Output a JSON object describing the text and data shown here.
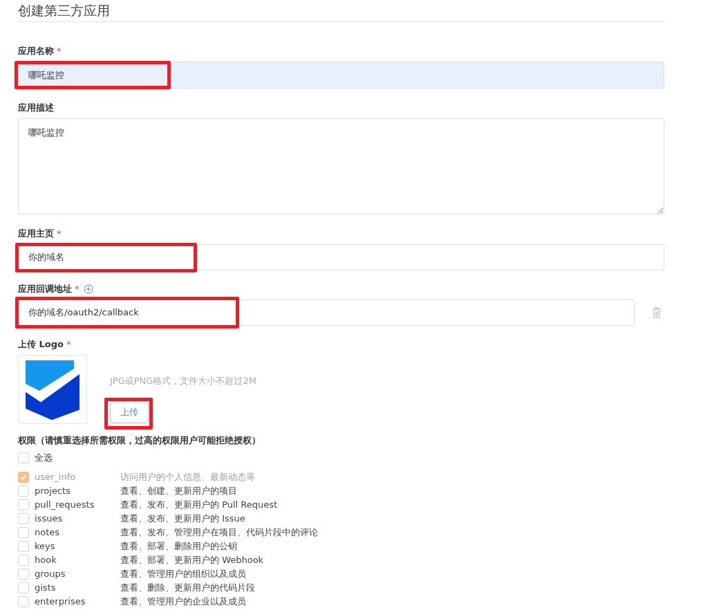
{
  "title": "创建第三方应用",
  "name_field": {
    "label": "应用名称",
    "required_mark": "*",
    "value": "哪吒监控",
    "autofilled": true,
    "highlighted": true
  },
  "description_field": {
    "label": "应用描述",
    "value": "哪吒监控"
  },
  "homepage_field": {
    "label": "应用主页",
    "required_mark": "*",
    "value": "你的域名",
    "highlighted": true
  },
  "callback_field": {
    "label": "应用回调地址",
    "required_mark": "*",
    "value": "你的域名/oauth2/callback",
    "highlighted": true
  },
  "logo": {
    "label": "上传 Logo",
    "required_mark": "*",
    "hint": "JPG或PNG格式，文件大小不超过2M",
    "upload_button": "上传",
    "button_highlighted": true
  },
  "permissions": {
    "label": "权限（请慎重选择所需权限，过高的权限用户可能拒绝授权）",
    "select_all": {
      "label": "全选",
      "checked": false
    },
    "items": [
      {
        "name": "user_info",
        "description": "访问用户的个人信息、最新动态等",
        "checked": true,
        "disabled": true
      },
      {
        "name": "projects",
        "description": "查看、创建、更新用户的项目",
        "checked": false,
        "disabled": false
      },
      {
        "name": "pull_requests",
        "description": "查看、发布、更新用户的 Pull Request",
        "checked": false,
        "disabled": false
      },
      {
        "name": "issues",
        "description": "查看、发布、更新用户的 Issue",
        "checked": false,
        "disabled": false
      },
      {
        "name": "notes",
        "description": "查看、发布、管理用户在项目、代码片段中的评论",
        "checked": false,
        "disabled": false
      },
      {
        "name": "keys",
        "description": "查看、部署、删除用户的公钥",
        "checked": false,
        "disabled": false
      },
      {
        "name": "hook",
        "description": "查看、部署、更新用户的 Webhook",
        "checked": false,
        "disabled": false
      },
      {
        "name": "groups",
        "description": "查看、管理用户的组织以及成员",
        "checked": false,
        "disabled": false
      },
      {
        "name": "gists",
        "description": "查看、删除、更新用户的代码片段",
        "checked": false,
        "disabled": false
      },
      {
        "name": "enterprises",
        "description": "查看、管理用户的企业以及成员",
        "checked": false,
        "disabled": false
      }
    ]
  }
}
